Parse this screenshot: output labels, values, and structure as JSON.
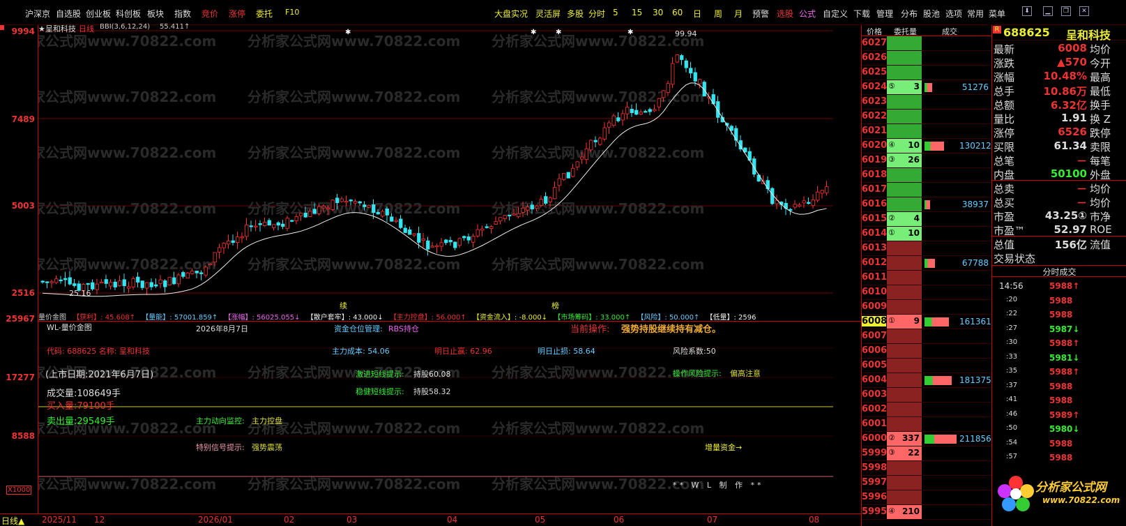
{
  "menu": {
    "items": [
      "沪深京",
      "自选股",
      "创业板",
      "科创板",
      "板块",
      "指数",
      "竞价",
      "涨停",
      "委托",
      "F10"
    ],
    "right_items": [
      "大盘实况",
      "灵活屏",
      "多股",
      "分时",
      "5",
      "15",
      "30",
      "60",
      "日",
      "周",
      "月",
      "预警",
      "选股",
      "公式",
      "自定义",
      "下载",
      "管理",
      "分布",
      "股池",
      "选项",
      "常用",
      "菜单"
    ]
  },
  "chart_header": {
    "title": "★呈和科技",
    "period": "日线",
    "indicator": "BBI(3,6,12,24)",
    "bbi_value": "55.411↑",
    "high_label": "99.94",
    "low_label": "25.16",
    "mark_xu": "续",
    "mark_bang": "榜"
  },
  "price_axis": [
    "9994",
    "7489",
    "5003",
    "2516"
  ],
  "ind_axis": [
    "25967",
    "17277",
    "8588"
  ],
  "ind_scale": "X1000",
  "period_tag": "日线▲",
  "date_axis": [
    "2025/11",
    "12",
    "2026/01",
    "02",
    "03",
    "04",
    "05",
    "06",
    "07",
    "08"
  ],
  "indicator_bar": [
    {
      "label": "量价金图",
      "color": "#ccc"
    },
    {
      "label": "【获利】: 45.608↑",
      "color": "#e33"
    },
    {
      "label": "【量能】: 57001.859↑",
      "color": "#6cf"
    },
    {
      "label": "【涨幅】: 56025.055↓",
      "color": "#e6e"
    },
    {
      "label": "【散户套牢】: 43.000↓",
      "color": "#eee"
    },
    {
      "label": "【主力控盘】: 56.000↑",
      "color": "#e33"
    },
    {
      "label": "【资金流入】: -8.000↓",
      "color": "#ee3"
    },
    {
      "label": "【市场筹码】: 33.000↑",
      "color": "#3e3"
    },
    {
      "label": "【风险】: 50.000↑",
      "color": "#6cf"
    },
    {
      "label": "【低量】: 2596",
      "color": "#eee"
    }
  ],
  "indicator_panel": {
    "name": "WL-量价金图",
    "date": "2026年8月7日",
    "fund_label": "资金仓位管理:",
    "fund_value": "RBS持仓",
    "current_op_label": "当前操作:",
    "current_op_value": "强势持股继续持有减仓。",
    "code_line": "代码: 688625 名称: 呈和科技",
    "main_cost": "主力成本: 54.06",
    "tomorrow_profit": "明日止赢: 62.96",
    "tomorrow_stop": "明日止损: 58.64",
    "risk": "风险系数:50",
    "listing_date": "(上市日期:2021年6月7日)",
    "aggressive_hint": "激进短线提示:",
    "aggressive_value": "持股60.08",
    "op_risk_hint": "操作风险提示:",
    "op_risk_value": "偏高注意",
    "volume": "成交量:108649手",
    "steady_hint": "稳健短线提示:",
    "steady_value": "持股58.32",
    "buy_volume": "买入量:79100手",
    "sell_volume": "卖出量:29549手",
    "main_monitor": "主力动向监控:",
    "main_monitor_value": "主力控盘",
    "special_signal": "特别信号提示:",
    "special_signal_value": "强势震荡",
    "add_fund": "增量资金→",
    "footer": "** W L 制 作 **"
  },
  "order_book": {
    "headers": [
      "价格",
      "委托量",
      "成交"
    ],
    "rows": [
      {
        "price": "6027",
        "qty": "",
        "vol": ""
      },
      {
        "price": "6026",
        "qty": "",
        "vol": ""
      },
      {
        "price": "6025",
        "qty": "",
        "vol": ""
      },
      {
        "price": "6024",
        "qty": "3",
        "tag": "⑤",
        "vol": "51276"
      },
      {
        "price": "6023",
        "qty": "",
        "vol": ""
      },
      {
        "price": "6022",
        "qty": "",
        "vol": ""
      },
      {
        "price": "6021",
        "qty": "",
        "vol": ""
      },
      {
        "price": "6020",
        "qty": "10",
        "tag": "④",
        "vol": "130212"
      },
      {
        "price": "6019",
        "qty": "26",
        "tag": "③",
        "vol": ""
      },
      {
        "price": "6018",
        "qty": "",
        "vol": ""
      },
      {
        "price": "6017",
        "qty": "",
        "vol": ""
      },
      {
        "price": "6016",
        "qty": "",
        "vol": "38937"
      },
      {
        "price": "6015",
        "qty": "4",
        "tag": "②",
        "vol": ""
      },
      {
        "price": "6014",
        "qty": "10",
        "tag": "①",
        "vol": ""
      },
      {
        "price": "6013",
        "qty": "",
        "vol": ""
      },
      {
        "price": "6012",
        "qty": "",
        "vol": "67788"
      },
      {
        "price": "6011",
        "qty": "",
        "vol": ""
      },
      {
        "price": "6010",
        "qty": "",
        "vol": ""
      },
      {
        "price": "6009",
        "qty": "",
        "vol": ""
      },
      {
        "price": "6008",
        "qty": "9",
        "tag": "①",
        "vol": "161361"
      },
      {
        "price": "6007",
        "qty": "",
        "vol": ""
      },
      {
        "price": "6006",
        "qty": "",
        "vol": ""
      },
      {
        "price": "6005",
        "qty": "",
        "vol": ""
      },
      {
        "price": "6004",
        "qty": "",
        "vol": "181375"
      },
      {
        "price": "6003",
        "qty": "",
        "vol": ""
      },
      {
        "price": "6002",
        "qty": "",
        "vol": ""
      },
      {
        "price": "6001",
        "qty": "",
        "vol": ""
      },
      {
        "price": "6000",
        "qty": "337",
        "tag": "②",
        "vol": "211856"
      },
      {
        "price": "5999",
        "qty": "22",
        "tag": "③",
        "vol": ""
      },
      {
        "price": "5998",
        "qty": "",
        "vol": ""
      },
      {
        "price": "5997",
        "qty": "",
        "vol": ""
      },
      {
        "price": "5996",
        "qty": "",
        "vol": ""
      },
      {
        "price": "5995",
        "qty": "210",
        "tag": "④",
        "vol": ""
      }
    ]
  },
  "quote": {
    "badge": "R",
    "code": "688625",
    "name": "呈和科技",
    "rows": [
      {
        "l": "最新",
        "v": "6008",
        "r": "均价"
      },
      {
        "l": "涨跌",
        "v": "▲570",
        "r": "今开"
      },
      {
        "l": "涨幅",
        "v": "10.48%",
        "r": "最高"
      },
      {
        "l": "总手",
        "v": "10.86万",
        "r": "最低"
      },
      {
        "l": "总额",
        "v": "6.32亿",
        "r": "换手"
      },
      {
        "l": "量比",
        "v": "1.91",
        "r": "换 Z"
      },
      {
        "l": "涨停",
        "v": "6526",
        "r": "跌停"
      },
      {
        "l": "买限",
        "v": "61.34",
        "r": "卖限"
      },
      {
        "l": "总笔",
        "v": "－",
        "r": "每笔"
      },
      {
        "l": "内盘",
        "v": "50100",
        "r": "外盘"
      },
      {
        "l": "总卖",
        "v": "－",
        "r": "均价"
      },
      {
        "l": "总买",
        "v": "－",
        "r": "均价"
      },
      {
        "l": "市盈",
        "v": "43.25①",
        "r": "市净"
      },
      {
        "l": "市盈™",
        "v": "52.97",
        "r": "ROE"
      },
      {
        "l": "总值",
        "v": "156亿",
        "r": "流值"
      },
      {
        "l": "交易状态",
        "v": "",
        "r": ""
      }
    ],
    "ticks_title": "分时成交",
    "ticks": [
      {
        "t": "14:56",
        "p": "5988↑"
      },
      {
        "t": ":20",
        "p": "5988"
      },
      {
        "t": ":22",
        "p": "5988"
      },
      {
        "t": ":27",
        "p": "5987↓"
      },
      {
        "t": ":30",
        "p": "5988↑"
      },
      {
        "t": ":33",
        "p": "5981↓"
      },
      {
        "t": ":35",
        "p": "5988↑"
      },
      {
        "t": ":37",
        "p": "5988"
      },
      {
        "t": ":41",
        "p": "5988"
      },
      {
        "t": ":46",
        "p": "5989↑"
      },
      {
        "t": ":50",
        "p": "5980↓"
      },
      {
        "t": ":54",
        "p": "5988"
      },
      {
        "t": ":57",
        "p": "5988"
      }
    ],
    "logo_text": "分析家公式网",
    "logo_url": "www.70822.com"
  },
  "watermark": "分析家公式网www.70822.com"
}
